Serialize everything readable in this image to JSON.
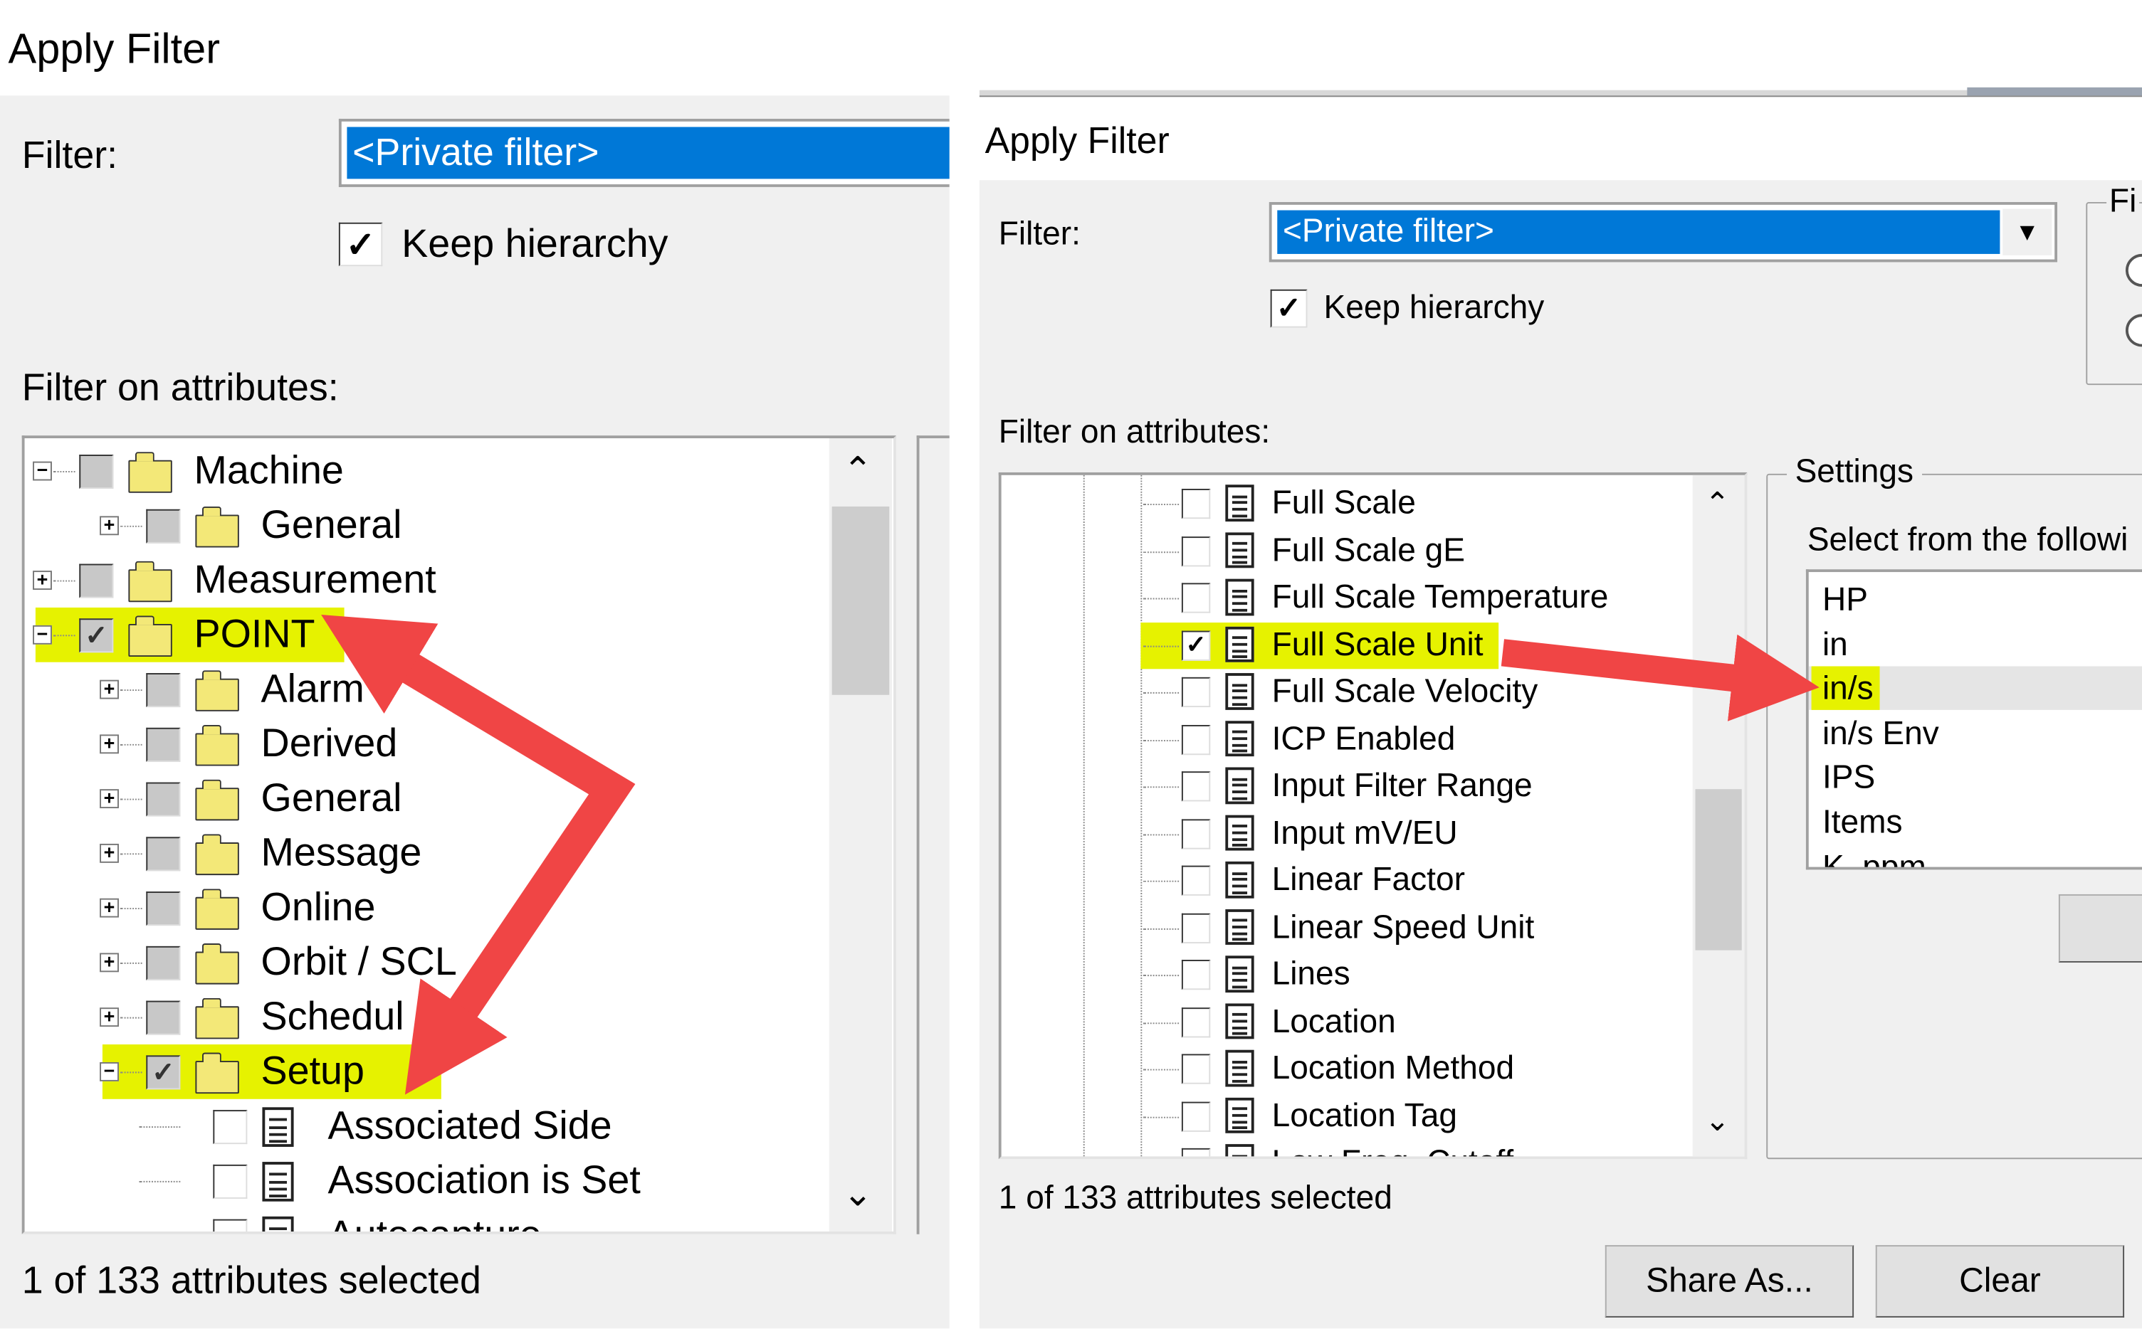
{
  "left": {
    "title": "Apply Filter",
    "filter_label": "Filter:",
    "filter_value": "<Private filter>",
    "keep_hierarchy": {
      "label": "Keep hierarchy",
      "checked": true
    },
    "attributes_label": "Filter on attributes:",
    "tree": [
      {
        "label": "Machine",
        "level": 0,
        "expander": "minus",
        "state": "partial",
        "type": "folder"
      },
      {
        "label": "General",
        "level": 1,
        "expander": "plus",
        "state": "partial",
        "type": "folder"
      },
      {
        "label": "Measurement",
        "level": 0,
        "expander": "plus",
        "state": "partial",
        "type": "folder"
      },
      {
        "label": "POINT",
        "level": 0,
        "expander": "minus",
        "state": "checked-partial",
        "type": "folder",
        "highlighted": true
      },
      {
        "label": "Alarm",
        "level": 1,
        "expander": "plus",
        "state": "partial",
        "type": "folder"
      },
      {
        "label": "Derived",
        "level": 1,
        "expander": "plus",
        "state": "partial",
        "type": "folder"
      },
      {
        "label": "General",
        "level": 1,
        "expander": "plus",
        "state": "partial",
        "type": "folder"
      },
      {
        "label": "Message",
        "level": 1,
        "expander": "plus",
        "state": "partial",
        "type": "folder"
      },
      {
        "label": "Online",
        "level": 1,
        "expander": "plus",
        "state": "partial",
        "type": "folder"
      },
      {
        "label": "Orbit / SCL",
        "level": 1,
        "expander": "plus",
        "state": "partial",
        "type": "folder"
      },
      {
        "label": "Schedul",
        "level": 1,
        "expander": "plus",
        "state": "partial",
        "type": "folder"
      },
      {
        "label": "Setup",
        "level": 1,
        "expander": "minus",
        "state": "checked-partial",
        "type": "folder",
        "highlighted": true
      },
      {
        "label": "Associated Side",
        "level": 2,
        "state": "unchecked",
        "type": "doc"
      },
      {
        "label": "Association is Set",
        "level": 2,
        "state": "unchecked",
        "type": "doc"
      },
      {
        "label": "Autocapture",
        "level": 2,
        "state": "unchecked",
        "type": "doc"
      }
    ],
    "status": "1 of 133 attributes selected"
  },
  "right": {
    "title": "Apply Filter",
    "filter_label": "Filter:",
    "filter_value": "<Private filter>",
    "keep_hierarchy": {
      "label": "Keep hierarchy",
      "checked": true
    },
    "group_label_partial": "Fi",
    "attributes_label": "Filter on attributes:",
    "tree": [
      {
        "label": "Full Scale",
        "checked": false
      },
      {
        "label": "Full Scale gE",
        "checked": false
      },
      {
        "label": "Full Scale Temperature",
        "checked": false
      },
      {
        "label": "Full Scale Unit",
        "checked": true,
        "highlighted": true
      },
      {
        "label": "Full Scale Velocity",
        "checked": false
      },
      {
        "label": "ICP Enabled",
        "checked": false
      },
      {
        "label": "Input Filter Range",
        "checked": false
      },
      {
        "label": "Input mV/EU",
        "checked": false
      },
      {
        "label": "Linear Factor",
        "checked": false
      },
      {
        "label": "Linear Speed Unit",
        "checked": false
      },
      {
        "label": "Lines",
        "checked": false
      },
      {
        "label": "Location",
        "checked": false
      },
      {
        "label": "Location Method",
        "checked": false
      },
      {
        "label": "Location Tag",
        "checked": false
      },
      {
        "label": "Low Freq. Cutoff",
        "checked": false
      }
    ],
    "settings": {
      "label": "Settings",
      "prompt": "Select from the followi",
      "options": [
        "HP",
        "in",
        "in/s",
        "in/s Env",
        "IPS",
        "Items",
        "K_ppm"
      ],
      "selected": "in/s"
    },
    "status": "1 of 133 attributes selected",
    "buttons": {
      "share": "Share As...",
      "clear": "Clear"
    }
  },
  "colors": {
    "selection_blue": "#0078d7",
    "highlight_yellow": "#e6f200",
    "arrow_red": "#f04545",
    "panel_grey": "#f0f0f0"
  }
}
